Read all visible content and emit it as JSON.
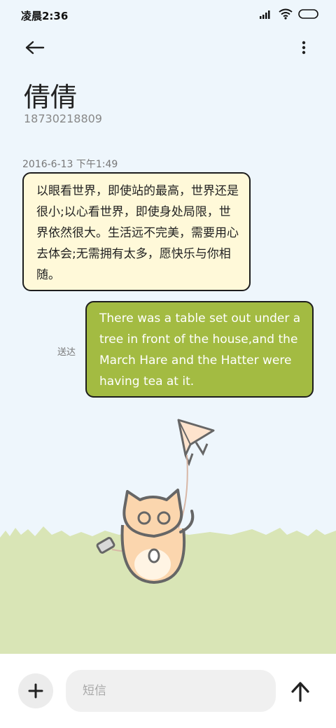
{
  "status_bar": {
    "time": "凌晨2:36",
    "icons": [
      "signal-icon",
      "wifi-icon",
      "battery-icon"
    ]
  },
  "header": {
    "back_icon": "back-arrow-icon",
    "more_icon": "more-vertical-icon",
    "contact_name": "倩倩",
    "contact_number": "18730218809"
  },
  "conversation": {
    "timestamp": "2016-6-13 下午1:49",
    "received_message": "以眼看世界，即使站的最高，世界还是很小;以心看世界，即使身处局限，世界依然很大。生活远不完美，需要用心去体会;无需拥有太多，愿快乐与你相随。",
    "sent_message": "There was a table set out under a tree in front of the house,and the March Hare and the Hatter were having tea at it.",
    "sent_status": "送达"
  },
  "composer": {
    "add_icon": "plus-icon",
    "placeholder": "短信",
    "value": "",
    "send_icon": "send-arrow-icon"
  },
  "colors": {
    "background": "#eef6fc",
    "received_bubble": "#fff9d9",
    "sent_bubble": "#a3bb42",
    "grass": "#d9e5b6"
  }
}
